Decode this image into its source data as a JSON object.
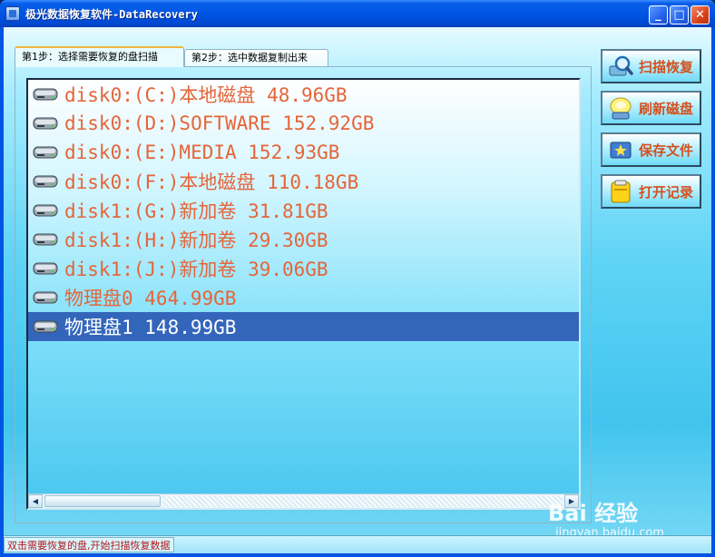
{
  "window": {
    "title": "极光数据恢复软件-DataRecovery",
    "min_glyph": "_",
    "max_glyph": "□",
    "close_glyph": "✕"
  },
  "tabs": [
    {
      "label": "第1步：选择需要恢复的盘扫描",
      "active": true
    },
    {
      "label": "第2步：选中数据复制出来",
      "active": false
    }
  ],
  "drives": [
    {
      "label": "disk0:(C:)本地磁盘 48.96GB",
      "selected": false,
      "icon": "hard-disk-icon"
    },
    {
      "label": "disk0:(D:)SOFTWARE 152.92GB",
      "selected": false,
      "icon": "hard-disk-icon"
    },
    {
      "label": "disk0:(E:)MEDIA 152.93GB",
      "selected": false,
      "icon": "hard-disk-icon"
    },
    {
      "label": "disk0:(F:)本地磁盘 110.18GB",
      "selected": false,
      "icon": "hard-disk-icon"
    },
    {
      "label": "disk1:(G:)新加卷 31.81GB",
      "selected": false,
      "icon": "hard-disk-icon"
    },
    {
      "label": "disk1:(H:)新加卷 29.30GB",
      "selected": false,
      "icon": "hard-disk-icon"
    },
    {
      "label": "disk1:(J:)新加卷 39.06GB",
      "selected": false,
      "icon": "hard-disk-icon"
    },
    {
      "label": "物理盘0 464.99GB",
      "selected": false,
      "icon": "hard-disk-icon"
    },
    {
      "label": "物理盘1 148.99GB",
      "selected": true,
      "icon": "hard-disk-icon"
    }
  ],
  "actions": [
    {
      "label": "扫描恢复",
      "icon": "magnifier-scan-icon"
    },
    {
      "label": "刷新磁盘",
      "icon": "refresh-disk-icon"
    },
    {
      "label": "保存文件",
      "icon": "save-file-icon"
    },
    {
      "label": "打开记录",
      "icon": "open-record-icon"
    }
  ],
  "status": {
    "text": "双击需要恢复的盘,开始扫描恢复数据"
  },
  "watermark": {
    "logo": "Bai 经验",
    "url": "jingyan.baidu.com"
  },
  "colors": {
    "drive_text": "#e4653a",
    "selection": "#3366bb",
    "button_text": "#d4501e",
    "status_text": "#b01818",
    "titlebar": "#0055e5"
  }
}
